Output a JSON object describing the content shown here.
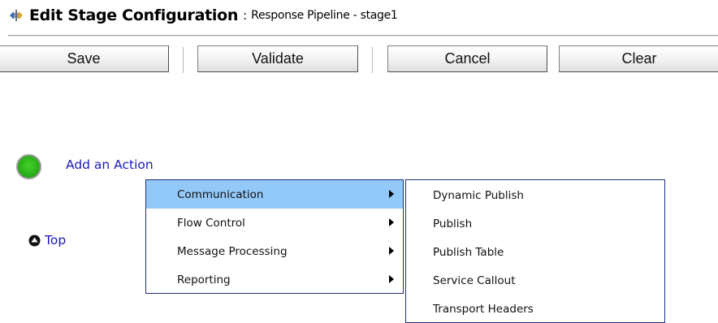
{
  "header": {
    "title": "Edit Stage Configuration",
    "separator": ":",
    "subtitle": "Response Pipeline - stage1"
  },
  "toolbar": {
    "save_label": "Save",
    "validate_label": "Validate",
    "cancel_label": "Cancel",
    "clear_label": "Clear"
  },
  "add_action": {
    "label": "Add an Action",
    "status_color": "#2cb219"
  },
  "top_link": {
    "label": "Top"
  },
  "action_menu": {
    "items": [
      {
        "label": "Communication",
        "highlighted": true
      },
      {
        "label": "Flow Control"
      },
      {
        "label": "Message Processing"
      },
      {
        "label": "Reporting"
      }
    ]
  },
  "communication_submenu": {
    "items": [
      {
        "label": "Dynamic Publish"
      },
      {
        "label": "Publish"
      },
      {
        "label": "Publish Table"
      },
      {
        "label": "Service Callout"
      },
      {
        "label": "Transport Headers"
      }
    ]
  },
  "colors": {
    "link": "#1a1ab8",
    "menu_highlight": "#93c9f8",
    "menu_border": "#1f2f7a"
  }
}
